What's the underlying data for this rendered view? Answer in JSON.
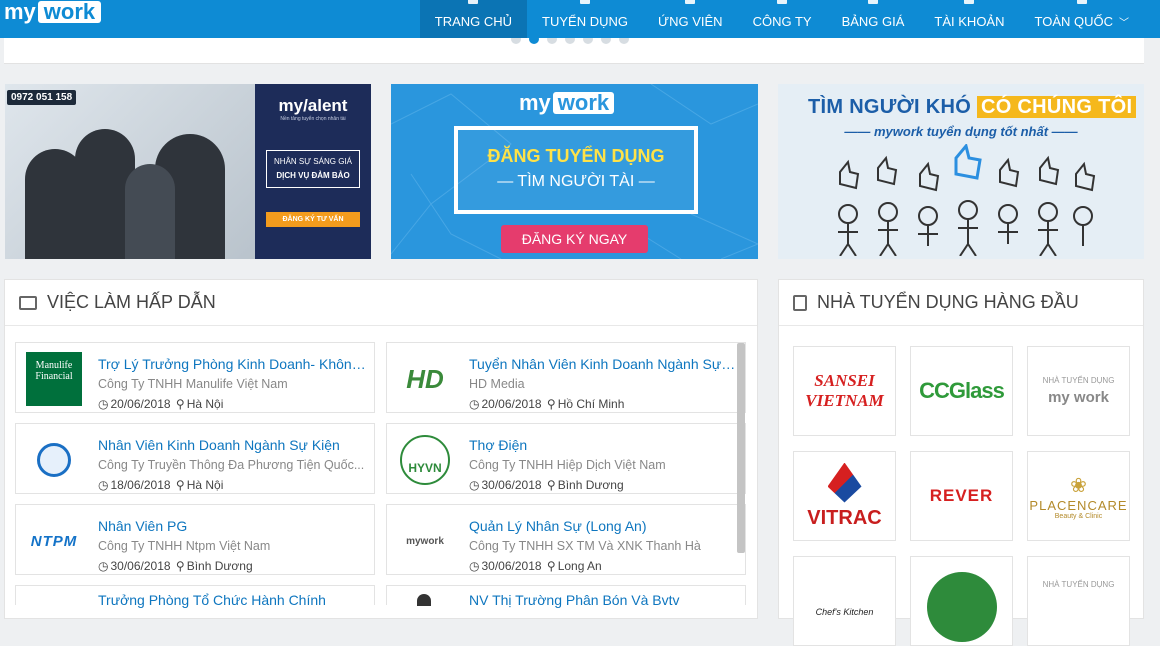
{
  "brand": {
    "logo_left": "my",
    "logo_right": "work"
  },
  "nav": {
    "items": [
      {
        "label": "Trang chủ",
        "icon": "home-icon",
        "active": true
      },
      {
        "label": "Tuyển dụng",
        "icon": "search-icon"
      },
      {
        "label": "Ứng viên",
        "icon": "user-icon"
      },
      {
        "label": "Công ty",
        "icon": "building-icon"
      },
      {
        "label": "Bảng giá",
        "icon": "price-icon"
      },
      {
        "label": "Tài khoản",
        "icon": "account-icon"
      },
      {
        "label": "Toàn quốc",
        "icon": "location-icon",
        "chevron": "﹀"
      }
    ]
  },
  "banners": {
    "mytalent": {
      "phone": "0972 051 158",
      "brand": "my/alent",
      "tag": "Nền tảng tuyển chọn nhân tài",
      "line1": "NHÂN SỰ SÁNG GIÁ",
      "line2": "DỊCH VỤ ĐẢM BẢO",
      "button": "ĐĂNG KÝ TƯ VẤN"
    },
    "mywork": {
      "logo_left": "my",
      "logo_right": "work",
      "line1": "ĐĂNG TUYỂN DỤNG",
      "line2": "— TÌM NGƯỜI TÀI —",
      "cta": "ĐĂNG KÝ NGAY"
    },
    "recruit": {
      "h1_a": "TÌM NGƯỜI KHÓ ",
      "h1_b": "CÓ CHÚNG TÔI",
      "h2": "—— mywork tuyển dụng tốt nhất ——"
    }
  },
  "jobs_section": {
    "title": "Việc làm hấp dẫn",
    "icon": "briefcase-icon"
  },
  "jobs": [
    {
      "title": "Trợ Lý Trưởng Phòng Kinh Doanh- Không ...",
      "company": "Công Ty TNHH Manulife Việt Nam",
      "date": "20/06/2018",
      "location": "Hà Nội",
      "logo": "Manulife Financial"
    },
    {
      "title": "Tuyển Nhân Viên Kinh Doanh Ngành Sự K...",
      "company": "HD Media",
      "date": "20/06/2018",
      "location": "Hồ Chí Minh",
      "logo": "HD"
    },
    {
      "title": "Nhân Viên Kinh Doanh Ngành Sự Kiện",
      "company": "Công Ty Truyền Thông Đa Phương Tiện Quốc...",
      "date": "18/06/2018",
      "location": "Hà Nội",
      "logo": "globe"
    },
    {
      "title": "Thợ Điện",
      "company": "Công Ty TNHH Hiệp Dịch Việt Nam",
      "date": "30/06/2018",
      "location": "Bình Dương",
      "logo": "HYVN"
    },
    {
      "title": "Nhân Viên PG",
      "company": "Công Ty TNHH Ntpm Việt Nam",
      "date": "30/06/2018",
      "location": "Bình Dương",
      "logo": "NTPM"
    },
    {
      "title": "Quản Lý Nhân Sự (Long An)",
      "company": "Công Ty TNHH SX TM Và XNK Thanh Hà",
      "date": "30/06/2018",
      "location": "Long An",
      "logo": "mywork"
    },
    {
      "title": "Trưởng Phòng Tổ Chức Hành Chính",
      "company": "",
      "date": "",
      "location": "",
      "logo": ""
    },
    {
      "title": "NV Thị Trường Phân Bón Và Bvtv",
      "company": "",
      "date": "",
      "location": "",
      "logo": "person"
    }
  ],
  "employers_section": {
    "title": "Nhà tuyển dụng hàng đầu",
    "icon": "building-icon"
  },
  "employers": [
    {
      "name": "SANSEI VIETNAM"
    },
    {
      "name": "CCGlass"
    },
    {
      "name": "my work",
      "caption": "NHÀ TUYỂN DỤNG"
    },
    {
      "name": "VITRAC"
    },
    {
      "name": "REVER"
    },
    {
      "name": "PLACENCARE",
      "sub": "Beauty & Clinic"
    },
    {
      "name": "Chef's Kitchen"
    },
    {
      "name": "green-logo"
    },
    {
      "name": "",
      "caption": "NHÀ TUYỂN DỤNG"
    }
  ],
  "colors": {
    "primary": "#0e8bd4",
    "link": "#0e76bf",
    "accent": "#e53c6d"
  }
}
